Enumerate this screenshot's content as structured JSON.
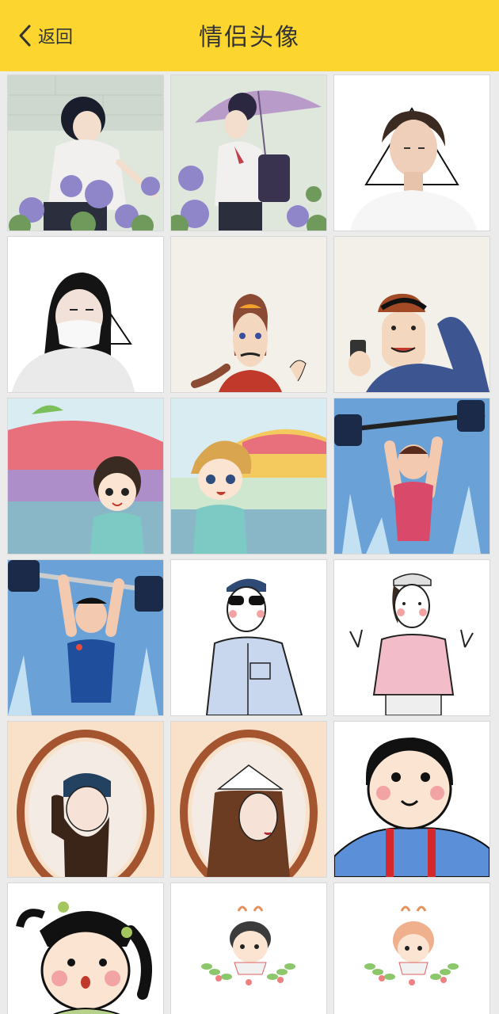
{
  "header": {
    "back_label": "返回",
    "title": "情侣头像",
    "background": "#fcd62f"
  },
  "avatars": [
    {
      "subject": "anime-boy-umbrella"
    },
    {
      "subject": "anime-girl-umbrella"
    },
    {
      "subject": "photo-boy-triangle"
    },
    {
      "subject": "photo-girl-mask-triangle"
    },
    {
      "subject": "cartoon-girl-mustache"
    },
    {
      "subject": "cartoon-boy-phone"
    },
    {
      "subject": "anime-girl-kindergarten"
    },
    {
      "subject": "anime-boy-kindergarten"
    },
    {
      "subject": "cartoon-girl-barbell"
    },
    {
      "subject": "cartoon-boy-barbell"
    },
    {
      "subject": "drawn-boy-sunglasses"
    },
    {
      "subject": "drawn-girl-peace-sign"
    },
    {
      "subject": "framed-bearded-man"
    },
    {
      "subject": "framed-woman-hat"
    },
    {
      "subject": "cartoon-boy-suspenders"
    },
    {
      "subject": "cartoon-girl-pigtails"
    },
    {
      "subject": "wreath-boy"
    },
    {
      "subject": "wreath-girl"
    }
  ]
}
